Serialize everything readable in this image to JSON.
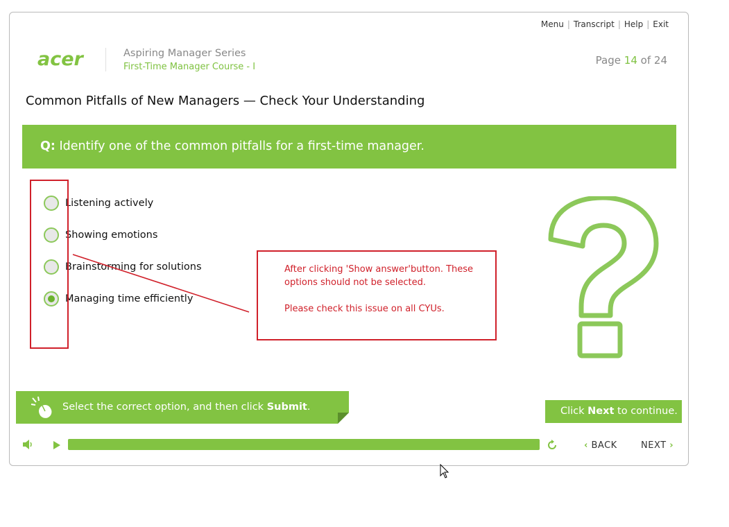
{
  "header": {
    "links": [
      "Menu",
      "Transcript",
      "Help",
      "Exit"
    ],
    "series": "Aspiring Manager Series",
    "course": "First-Time Manager Course - I",
    "page_label": "Page",
    "page_current": "14",
    "page_of": "of",
    "page_total": "24",
    "logo_text": "acer"
  },
  "title": "Common Pitfalls of New Managers — Check Your Understanding",
  "question": {
    "prefix": "Q:",
    "text": " Identify one of the common pitfalls for a first-time manager."
  },
  "options": [
    {
      "label": "Listening actively",
      "selected": false
    },
    {
      "label": "Showing emotions",
      "selected": false
    },
    {
      "label": "Brainstorming for solutions",
      "selected": false
    },
    {
      "label": "Managing time efficiently",
      "selected": true
    }
  ],
  "annotation": {
    "line1": "After clicking 'Show answer'button. These options should not be selected.",
    "line2": "Please check this issue on all CYUs."
  },
  "instruction": {
    "before": "Select the correct option, and then click ",
    "bold": "Submit",
    "after": "."
  },
  "continue": {
    "before": "Click ",
    "bold": "Next",
    "after": " to continue."
  },
  "controls": {
    "back_label": "BACK",
    "next_label": "NEXT",
    "progress": 1.0
  },
  "colors": {
    "accent": "#82c342",
    "annotation": "#d0202a"
  }
}
